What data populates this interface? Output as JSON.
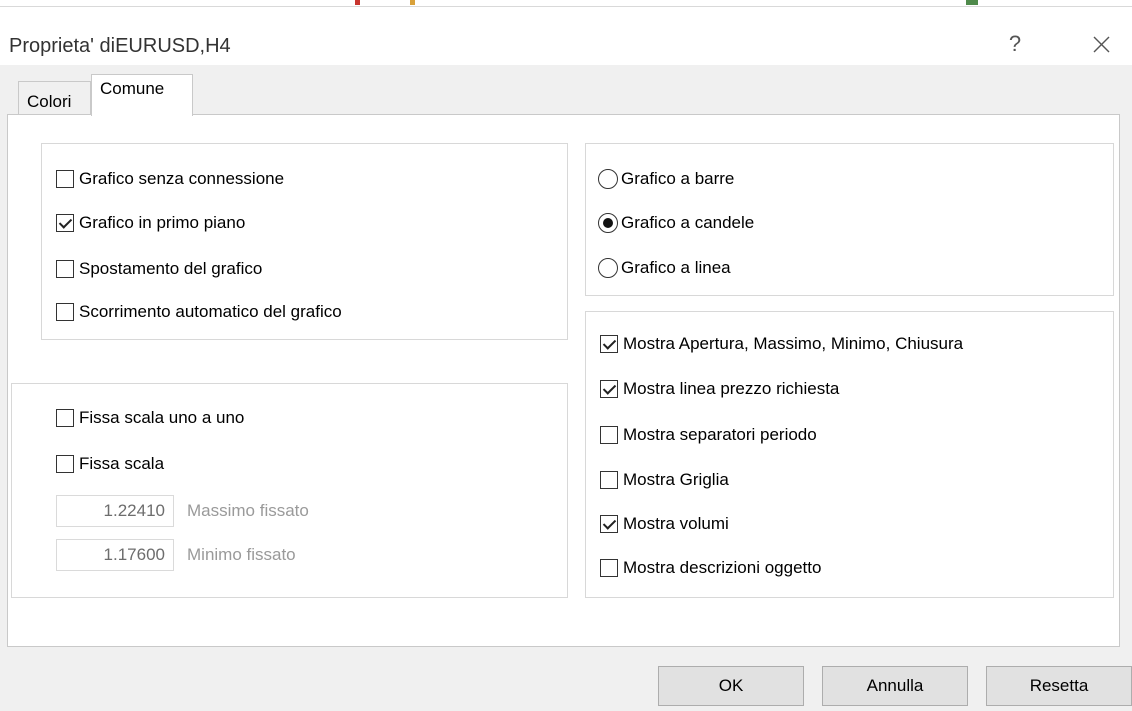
{
  "window": {
    "title": "Proprieta' diEURUSD,H4",
    "help_label": "?"
  },
  "tabs": [
    {
      "label": "Colori"
    },
    {
      "label": "Comune"
    }
  ],
  "options": {
    "offline_chart": {
      "label": "Grafico senza connessione",
      "checked": false
    },
    "chart_on_foreground": {
      "label": "Grafico in primo piano",
      "checked": true
    },
    "chart_shift": {
      "label": "Spostamento del grafico",
      "checked": false
    },
    "chart_autoscroll": {
      "label": "Scorrimento automatico del grafico",
      "checked": false
    }
  },
  "scale": {
    "fix_one_to_one": {
      "label": "Fissa scala uno a uno",
      "checked": false
    },
    "fix_scale": {
      "label": "Fissa scala",
      "checked": false
    },
    "fixed_max": {
      "value": "1.22410",
      "label": "Massimo fissato"
    },
    "fixed_min": {
      "value": "1.17600",
      "label": "Minimo fissato"
    }
  },
  "chart_type": {
    "bars": {
      "label": "Grafico a barre",
      "selected": false
    },
    "candles": {
      "label": "Grafico a candele",
      "selected": true
    },
    "line": {
      "label": "Grafico a linea",
      "selected": false
    }
  },
  "show": {
    "ohlc": {
      "label": "Mostra Apertura, Massimo, Minimo, Chiusura",
      "checked": true
    },
    "ask_line": {
      "label": "Mostra linea prezzo richiesta",
      "checked": true
    },
    "period_separators": {
      "label": "Mostra separatori periodo",
      "checked": false
    },
    "grid": {
      "label": "Mostra Griglia",
      "checked": false
    },
    "volumes": {
      "label": "Mostra volumi",
      "checked": true
    },
    "object_descriptions": {
      "label": "Mostra descrizioni oggetto",
      "checked": false
    }
  },
  "buttons": {
    "ok": "OK",
    "cancel": "Annulla",
    "reset": "Resetta"
  }
}
